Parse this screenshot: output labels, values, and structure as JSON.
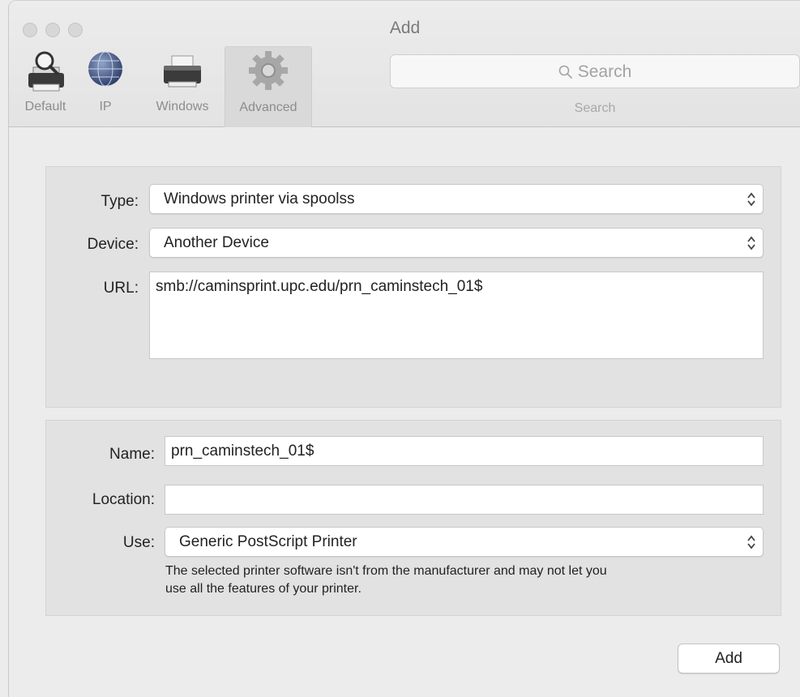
{
  "window": {
    "title": "Add"
  },
  "toolbar": {
    "items": [
      {
        "label": "Default",
        "icon": "printer-magnifier-icon"
      },
      {
        "label": "IP",
        "icon": "globe-icon"
      },
      {
        "label": "Windows",
        "icon": "windows-printer-icon"
      },
      {
        "label": "Advanced",
        "icon": "gear-icon",
        "selected": true
      }
    ],
    "search": {
      "placeholder": "Search",
      "label": "Search"
    }
  },
  "connection": {
    "type_label": "Type:",
    "type_value": "Windows printer via spoolss",
    "device_label": "Device:",
    "device_value": "Another Device",
    "url_label": "URL:",
    "url_value": "smb://caminsprint.upc.edu/prn_caminstech_01$"
  },
  "printer": {
    "name_label": "Name:",
    "name_value": "prn_caminstech_01$",
    "location_label": "Location:",
    "location_value": "",
    "use_label": "Use:",
    "use_value": "Generic PostScript Printer",
    "note_line1": "The selected printer software isn't from the manufacturer and may not let you",
    "note_line2": "use all the features of your printer."
  },
  "buttons": {
    "add": "Add"
  }
}
